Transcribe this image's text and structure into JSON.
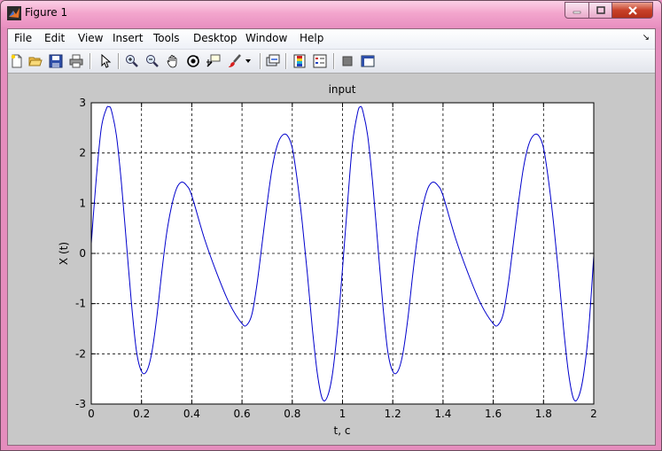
{
  "window": {
    "title": "Figure 1",
    "colors": {
      "frame": "#e88fc0",
      "close_button": "#c8412a",
      "figure_bg": "#c8c8c8",
      "line": "#0000cc"
    }
  },
  "menubar": {
    "items": [
      "File",
      "Edit",
      "View",
      "Insert",
      "Tools",
      "Desktop",
      "Window",
      "Help"
    ],
    "dock_icon": "dock-arrow-icon"
  },
  "toolbar": {
    "buttons": [
      "new-figure-icon",
      "open-file-icon",
      "save-icon",
      "print-icon",
      "edit-plot-arrow-icon",
      "zoom-in-icon",
      "zoom-out-icon",
      "pan-hand-icon",
      "rotate-3d-icon",
      "data-cursor-icon",
      "brush-icon",
      "brush-dropdown-icon",
      "link-plot-icon",
      "colorbar-icon",
      "legend-icon",
      "hide-plot-tools-icon",
      "show-plot-tools-icon"
    ]
  },
  "chart_data": {
    "type": "line",
    "title": "input",
    "xlabel": "t, c",
    "ylabel": "X (t)",
    "xlim": [
      0,
      2
    ],
    "ylim": [
      -3,
      3
    ],
    "xticks": [
      "0",
      "0.2",
      "0.4",
      "0.6",
      "0.8",
      "1",
      "1.2",
      "1.4",
      "1.6",
      "1.8",
      "2"
    ],
    "yticks": [
      "3",
      "2",
      "1",
      "0",
      "-1",
      "-2",
      "-3"
    ],
    "grid": true,
    "grid_style": "dashed",
    "series": [
      {
        "x": [
          0,
          0.02,
          0.04,
          0.06,
          0.07,
          0.08,
          0.1,
          0.12,
          0.14,
          0.16,
          0.18,
          0.2,
          0.22,
          0.24,
          0.26,
          0.28,
          0.3,
          0.32,
          0.34,
          0.36,
          0.38,
          0.4,
          0.45,
          0.5,
          0.55,
          0.6,
          0.62,
          0.64,
          0.66,
          0.68,
          0.7,
          0.72,
          0.74,
          0.76,
          0.78,
          0.8,
          0.82,
          0.84,
          0.86,
          0.88,
          0.9,
          0.92,
          0.94,
          0.96,
          0.98,
          1.0,
          1.02,
          1.04,
          1.06,
          1.07,
          1.08,
          1.1,
          1.12,
          1.14,
          1.16,
          1.18,
          1.2,
          1.22,
          1.24,
          1.26,
          1.28,
          1.3,
          1.32,
          1.34,
          1.36,
          1.38,
          1.4,
          1.45,
          1.5,
          1.55,
          1.6,
          1.62,
          1.64,
          1.66,
          1.68,
          1.7,
          1.72,
          1.74,
          1.76,
          1.78,
          1.8,
          1.82,
          1.84,
          1.86,
          1.88,
          1.9,
          1.92,
          1.94,
          1.96,
          1.98,
          2.0
        ],
        "y": [
          0.2,
          1.5,
          2.5,
          2.88,
          2.92,
          2.85,
          2.35,
          1.4,
          0.2,
          -1.0,
          -1.95,
          -2.35,
          -2.35,
          -2.0,
          -1.3,
          -0.4,
          0.4,
          0.95,
          1.3,
          1.42,
          1.35,
          1.15,
          0.3,
          -0.4,
          -1.0,
          -1.4,
          -1.42,
          -1.2,
          -0.6,
          0.2,
          1.0,
          1.7,
          2.15,
          2.35,
          2.35,
          2.1,
          1.45,
          0.6,
          -0.4,
          -1.5,
          -2.4,
          -2.9,
          -2.85,
          -2.4,
          -1.5,
          -0.3,
          1.0,
          2.2,
          2.8,
          2.92,
          2.85,
          2.35,
          1.4,
          0.2,
          -1.0,
          -1.95,
          -2.35,
          -2.35,
          -2.0,
          -1.3,
          -0.4,
          0.4,
          0.95,
          1.3,
          1.42,
          1.35,
          1.15,
          0.3,
          -0.4,
          -1.0,
          -1.4,
          -1.42,
          -1.2,
          -0.6,
          0.2,
          1.0,
          1.7,
          2.15,
          2.35,
          2.35,
          2.1,
          1.45,
          0.6,
          -0.4,
          -1.5,
          -2.4,
          -2.9,
          -2.85,
          -2.4,
          -1.5,
          -0.05
        ]
      }
    ]
  }
}
